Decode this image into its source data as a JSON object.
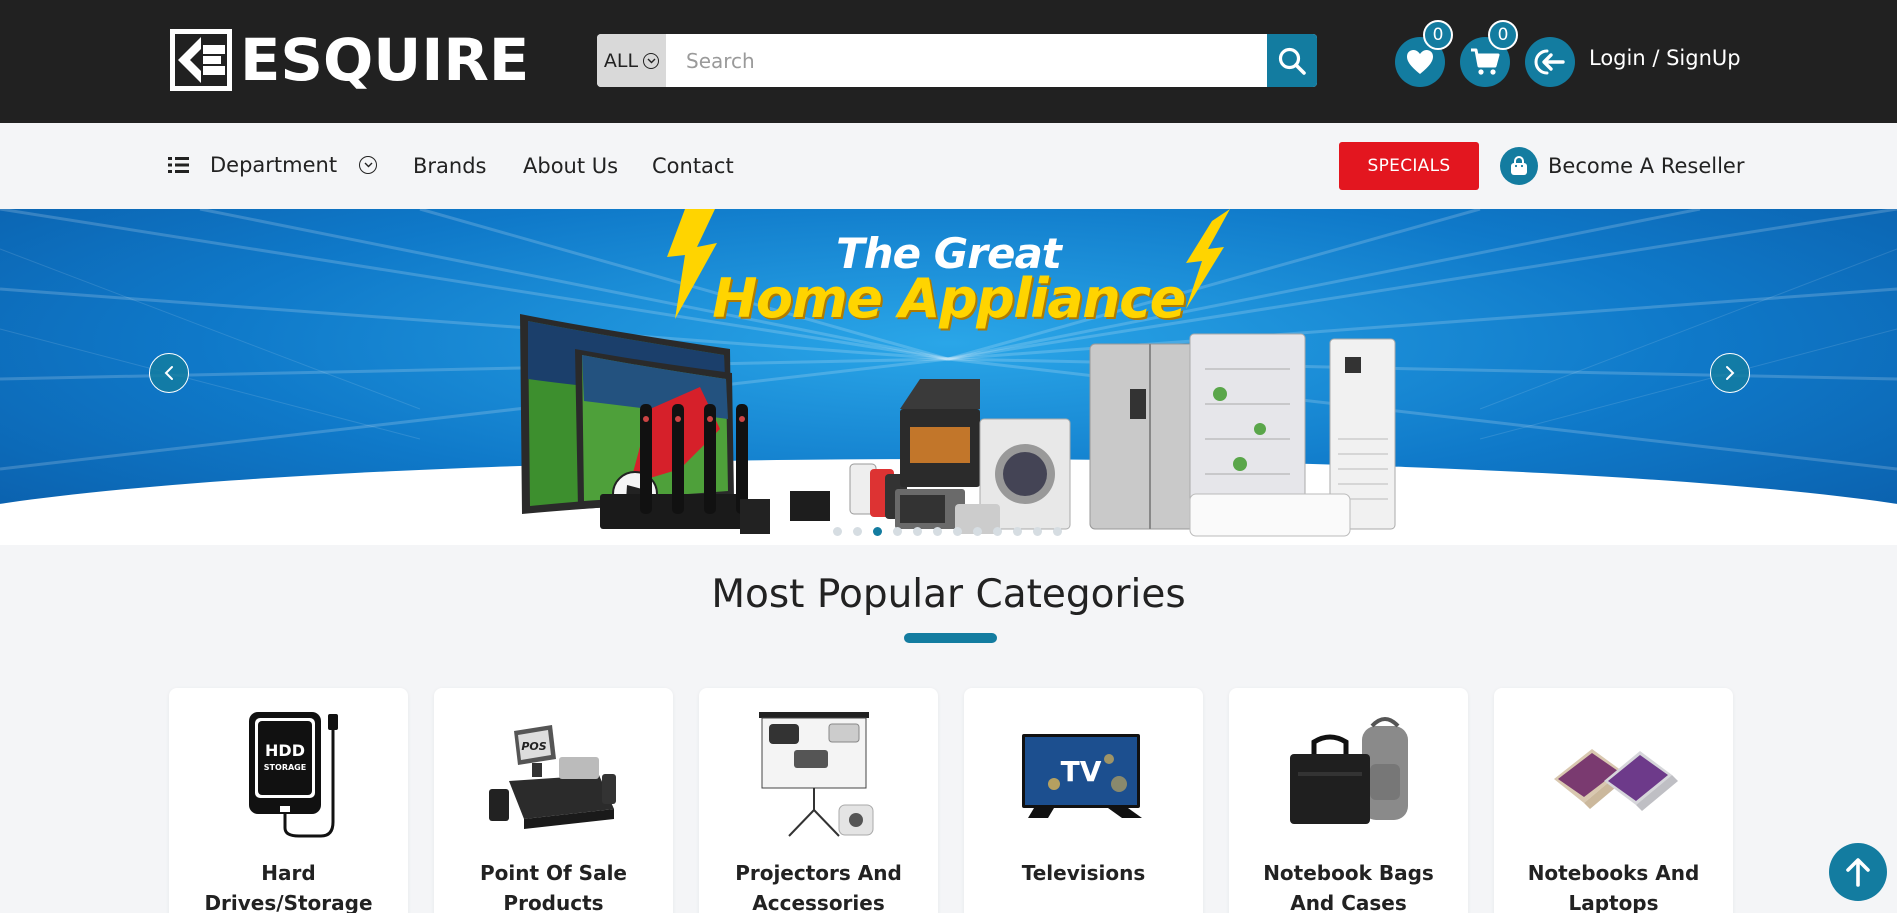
{
  "header": {
    "logo_text": "ESQUIRE",
    "search": {
      "category": "ALL",
      "placeholder": "Search"
    },
    "wishlist_count": "0",
    "cart_count": "0",
    "login_label": "Login / SignUp"
  },
  "nav": {
    "department_label": "Department",
    "links": [
      "Brands",
      "About Us",
      "Contact"
    ],
    "specials_label": "SPECIALS",
    "reseller_label": "Become A Reseller"
  },
  "hero": {
    "title_line1": "The Great",
    "title_line2": "Home Appliance",
    "slide_count": 12,
    "active_slide": 3
  },
  "categories": {
    "title": "Most Popular Categories",
    "items": [
      {
        "label": "Hard Drives/Storage",
        "icon": "hdd-icon"
      },
      {
        "label": "Point Of Sale Products",
        "icon": "pos-terminal-icon"
      },
      {
        "label": "Projectors And Accessories",
        "icon": "projector-icon"
      },
      {
        "label": "Televisions",
        "icon": "tv-icon"
      },
      {
        "label": "Notebook Bags And Cases",
        "icon": "laptop-bag-icon"
      },
      {
        "label": "Notebooks And Laptops",
        "icon": "laptop-icon"
      }
    ]
  },
  "colors": {
    "accent": "#137ca0",
    "topbar": "#212121",
    "specials": "#e3161f",
    "hero_title_yellow": "#ffd400"
  }
}
